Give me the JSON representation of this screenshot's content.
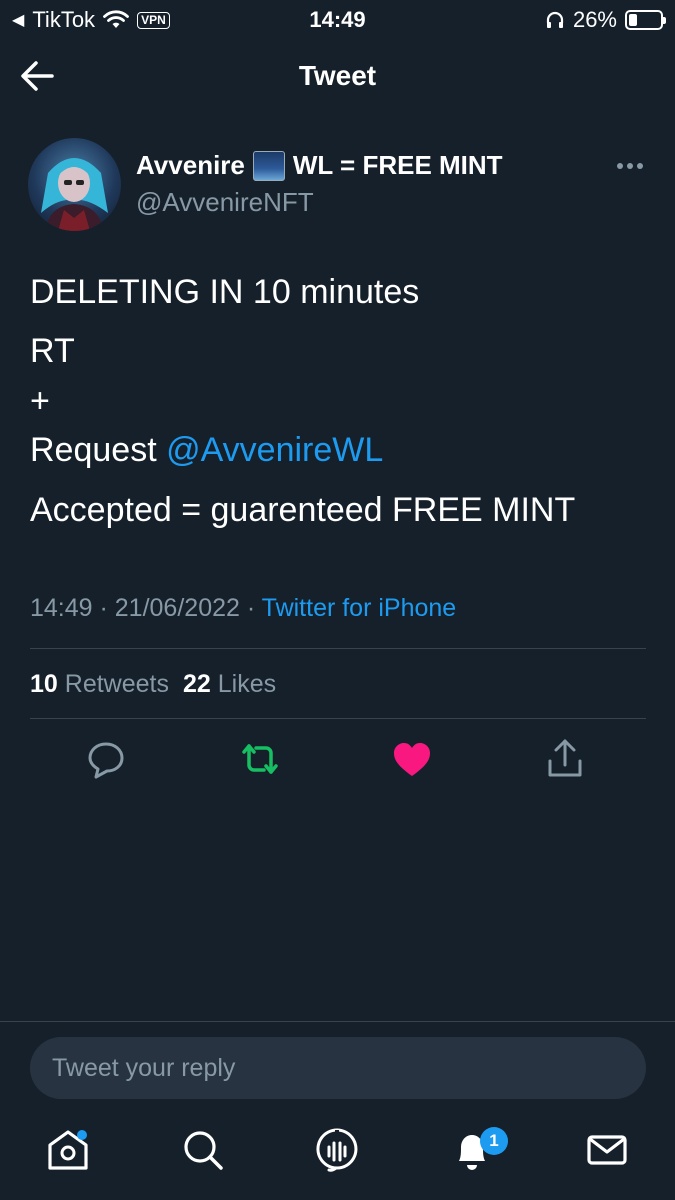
{
  "status_bar": {
    "back_indicator": "◀",
    "back_app": "TikTok",
    "vpn_label": "VPN",
    "time": "14:49",
    "battery_percent": "26%",
    "battery_level": 0.26
  },
  "header": {
    "title": "Tweet"
  },
  "tweet": {
    "author_name_prefix": "Avvenire",
    "author_name_suffix": "WL = FREE MINT",
    "author_handle": "@AvvenireNFT",
    "lines": {
      "line1": "DELETING IN 10 minutes",
      "line2": "RT",
      "line3": "+",
      "line4_prefix": "Request ",
      "line4_mention": "@AvvenireWL",
      "line5": "Accepted = guarenteed FREE MINT"
    },
    "timestamp": "14:49 · 21/06/2022 · ",
    "source": "Twitter for iPhone",
    "retweets_count": "10",
    "retweets_label": "Retweets",
    "likes_count": "22",
    "likes_label": "Likes"
  },
  "reply": {
    "placeholder": "Tweet your reply"
  },
  "tabbar": {
    "notifications_badge": "1"
  },
  "colors": {
    "background": "#15202b",
    "accent": "#1d9bf0",
    "retweet_green": "#17bf63",
    "like_pink": "#f91880",
    "muted": "#8899a6"
  }
}
